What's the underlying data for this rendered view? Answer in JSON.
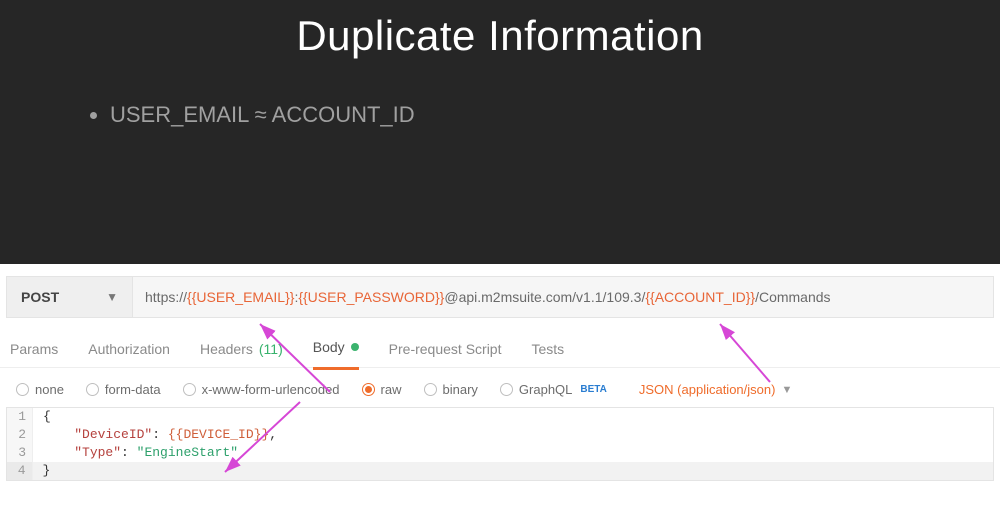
{
  "slide": {
    "title": "Duplicate Information",
    "bullet": "USER_EMAIL ≈ ACCOUNT_ID"
  },
  "request": {
    "method": "POST",
    "url_pre": "https://",
    "url_var1": "{{USER_EMAIL}}",
    "url_sep1": ":",
    "url_var2": "{{USER_PASSWORD}}",
    "url_mid": "@api.m2msuite.com/v1.1/109.3/",
    "url_var3": "{{ACCOUNT_ID}}",
    "url_post": "/Commands"
  },
  "tabs": {
    "params": "Params",
    "auth": "Authorization",
    "headers_label": "Headers",
    "headers_count": "(11)",
    "body": "Body",
    "prs": "Pre-request Script",
    "tests": "Tests"
  },
  "bodyopts": {
    "none": "none",
    "formdata": "form-data",
    "xwww": "x-www-form-urlencoded",
    "raw": "raw",
    "binary": "binary",
    "graphql": "GraphQL",
    "beta": "BETA",
    "ctype": "JSON (application/json)"
  },
  "editor": {
    "l1": "{",
    "l2_k": "\"DeviceID\"",
    "l2_s": ": ",
    "l2_v": "{{DEVICE_ID}}",
    "l2_t": ",",
    "l3_k": "\"Type\"",
    "l3_s": ": ",
    "l3_v": "\"EngineStart\"",
    "l4": "}"
  },
  "lineno": {
    "l1": "1",
    "l2": "2",
    "l3": "3",
    "l4": "4"
  }
}
